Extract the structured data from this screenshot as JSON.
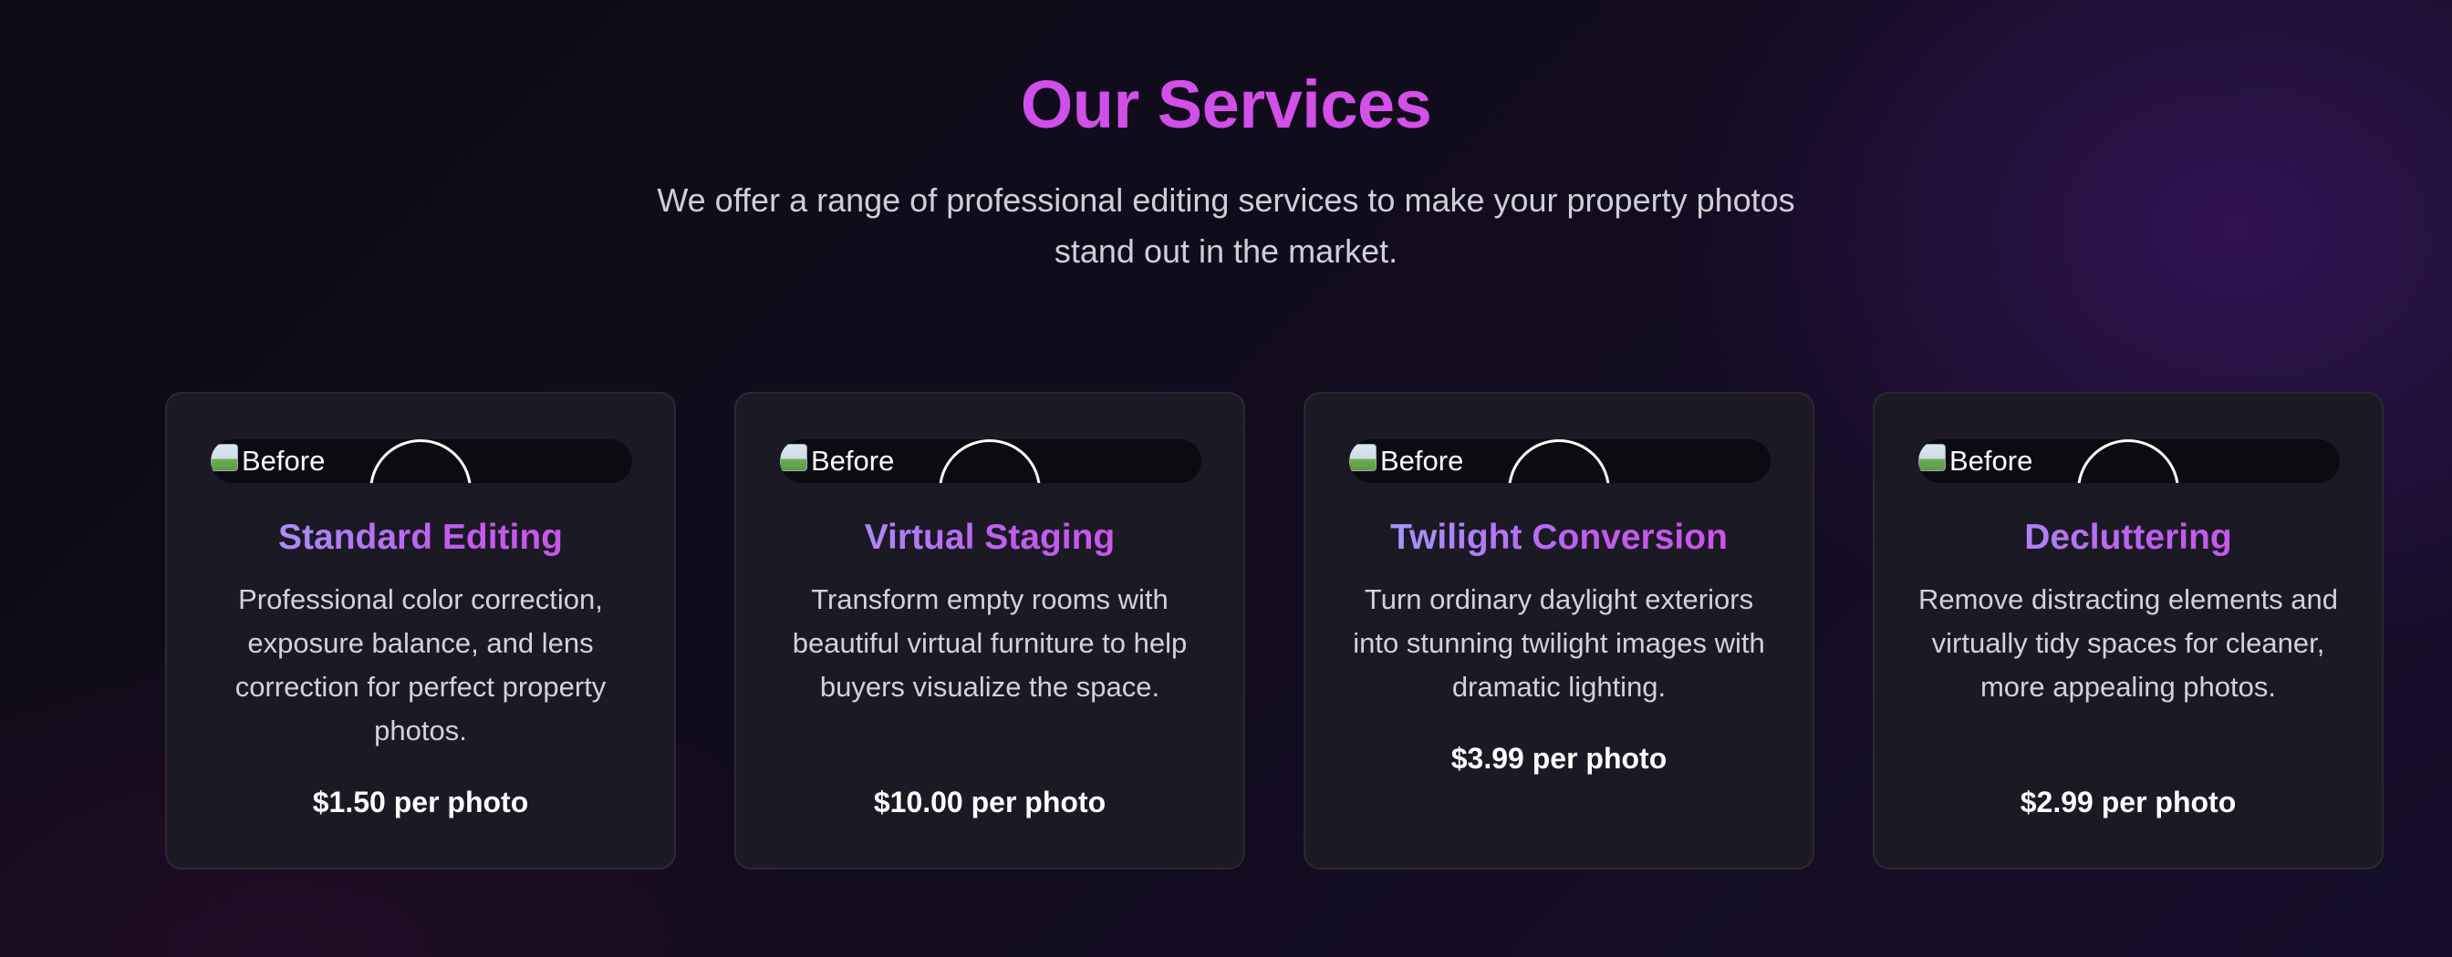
{
  "section": {
    "title": "Our Services",
    "subtitle": "We offer a range of professional editing services to make your property photos stand out in the market."
  },
  "colors": {
    "title_accent": "#d652ec",
    "card_background": "#1b1a24",
    "page_background": "#0d0b16"
  },
  "services": [
    {
      "image_alt": "Before",
      "title": "Standard Editing",
      "description": "Professional color correction, exposure balance, and lens correction for perfect property photos.",
      "price": "$1.50 per photo"
    },
    {
      "image_alt": "Before",
      "title": "Virtual Staging",
      "description": "Transform empty rooms with beautiful virtual furniture to help buyers visualize the space.",
      "price": "$10.00 per photo"
    },
    {
      "image_alt": "Before",
      "title": "Twilight Conversion",
      "description": "Turn ordinary daylight exteriors into stunning twilight images with dramatic lighting.",
      "price": "$3.99 per photo"
    },
    {
      "image_alt": "Before",
      "title": "Decluttering",
      "description": "Remove distracting elements and virtually tidy spaces for cleaner, more appealing photos.",
      "price": "$2.99 per photo"
    }
  ]
}
